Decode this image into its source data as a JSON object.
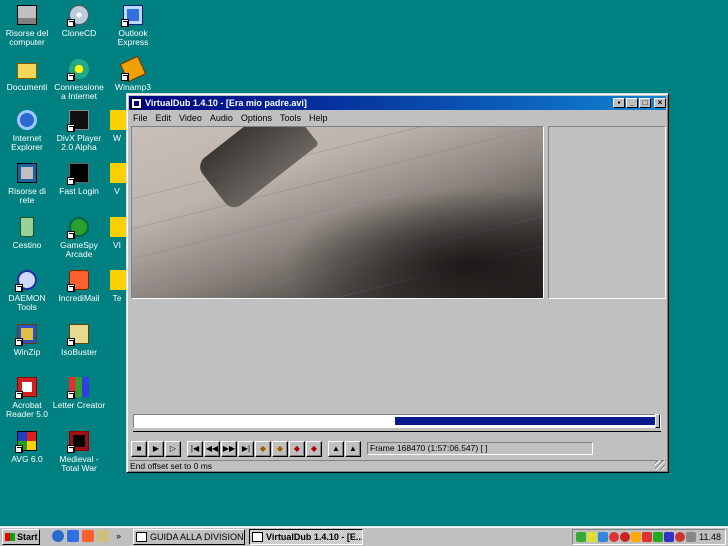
{
  "desktop": {
    "icons": [
      {
        "label": "Risorse del computer",
        "icon": "computer-icon"
      },
      {
        "label": "CloneCD",
        "icon": "disc-icon"
      },
      {
        "label": "Outlook Express",
        "icon": "mail-icon"
      },
      {
        "label": "Documenti",
        "icon": "folder-icon"
      },
      {
        "label": "Connessione a Internet",
        "icon": "internet-icon"
      },
      {
        "label": "Winamp3",
        "icon": "winamp-icon"
      },
      {
        "label": "Internet Explorer",
        "icon": "ie-icon"
      },
      {
        "label": "DivX Player 2.0 Alpha",
        "icon": "divx-icon"
      },
      {
        "label": "Risorse di rete",
        "icon": "network-icon"
      },
      {
        "label": "Fast Login",
        "icon": "fastlogin-icon"
      },
      {
        "label": "Cestino",
        "icon": "recycle-bin-icon"
      },
      {
        "label": "GameSpy Arcade",
        "icon": "gamespy-icon"
      },
      {
        "label": "DAEMON Tools",
        "icon": "daemon-icon"
      },
      {
        "label": "IncrediMail",
        "icon": "incredimail-icon"
      },
      {
        "label": "WinZip",
        "icon": "winzip-icon"
      },
      {
        "label": "IsoBuster",
        "icon": "isobuster-icon"
      },
      {
        "label": "Acrobat Reader 5.0",
        "icon": "acrobat-icon"
      },
      {
        "label": "Letter Creator",
        "icon": "letter-icon"
      },
      {
        "label": "AVG 6.0",
        "icon": "avg-icon"
      },
      {
        "label": "Medieval - Total War",
        "icon": "medieval-icon"
      }
    ],
    "partial_labels": [
      "W",
      "V",
      "V",
      "VI",
      "Te"
    ]
  },
  "window": {
    "title": "VirtualDub 1.4.10 - [Era mio padre.avi]",
    "menu": [
      "File",
      "Edit",
      "Video",
      "Audio",
      "Options",
      "Tools",
      "Help"
    ],
    "frame_info": "Frame 168470 (1:57:06.547) [ ]",
    "status": "End offset set to 0 ms",
    "seek_progress": 0.5,
    "controls": [
      "stop",
      "play-input",
      "play-output",
      "start",
      "prev-key",
      "next-key",
      "end",
      "key-prev",
      "key-next",
      "scene-prev",
      "scene-next",
      "mark-in",
      "mark-out"
    ]
  },
  "taskbar": {
    "start_label": "Start",
    "tasks": [
      {
        "label": "GUIDA ALLA DIVISIONS...",
        "active": false
      },
      {
        "label": "VirtualDub 1.4.10 - [E...",
        "active": true
      }
    ],
    "quicklaunch_more": "»",
    "clock": "11.48"
  },
  "colors": {
    "desktop": "#008080",
    "titlebar_start": "#000080",
    "titlebar_end": "#1084d0",
    "seek_fill": "#0a1c8c"
  }
}
